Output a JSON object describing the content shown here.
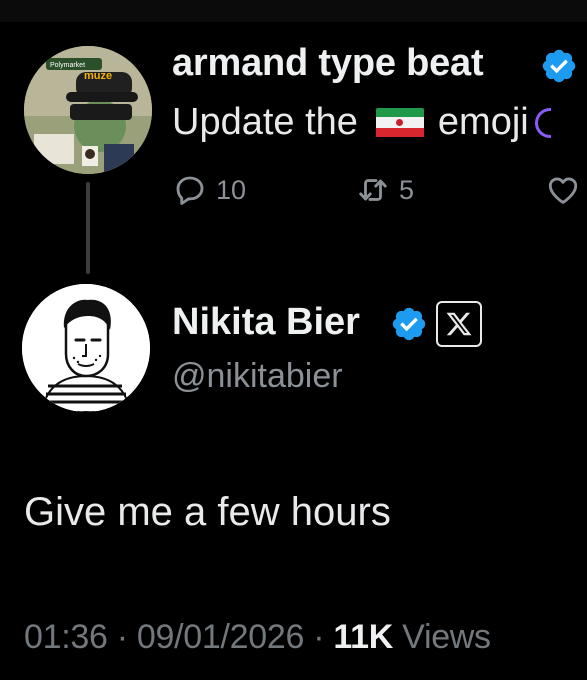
{
  "parent_tweet": {
    "author_name": "armand type beat",
    "text_before": "Update the",
    "text_after": "emoji",
    "reply_count": "10",
    "retweet_count": "5",
    "avatar_cap_text": "muze",
    "avatar_sticker_text": "Polymarket"
  },
  "main_tweet": {
    "author_name": "Nikita Bier",
    "handle": "@nikitabier",
    "text": "Give me a few hours",
    "time": "01:36",
    "sep1": " · ",
    "date": "09/01/2026",
    "sep2": " · ",
    "views_count": "11K",
    "views_label": " Views"
  },
  "colors": {
    "background": "#000000",
    "verified": "#1d9bf0",
    "muted_text": "#8b9197",
    "primary_text": "#e7e9ea"
  },
  "icons": {
    "reply": "reply-icon",
    "retweet": "retweet-icon",
    "like": "heart-icon",
    "verified": "verified-badge-icon",
    "affiliate": "x-logo-icon",
    "flag": "iran-flag-emoji"
  }
}
